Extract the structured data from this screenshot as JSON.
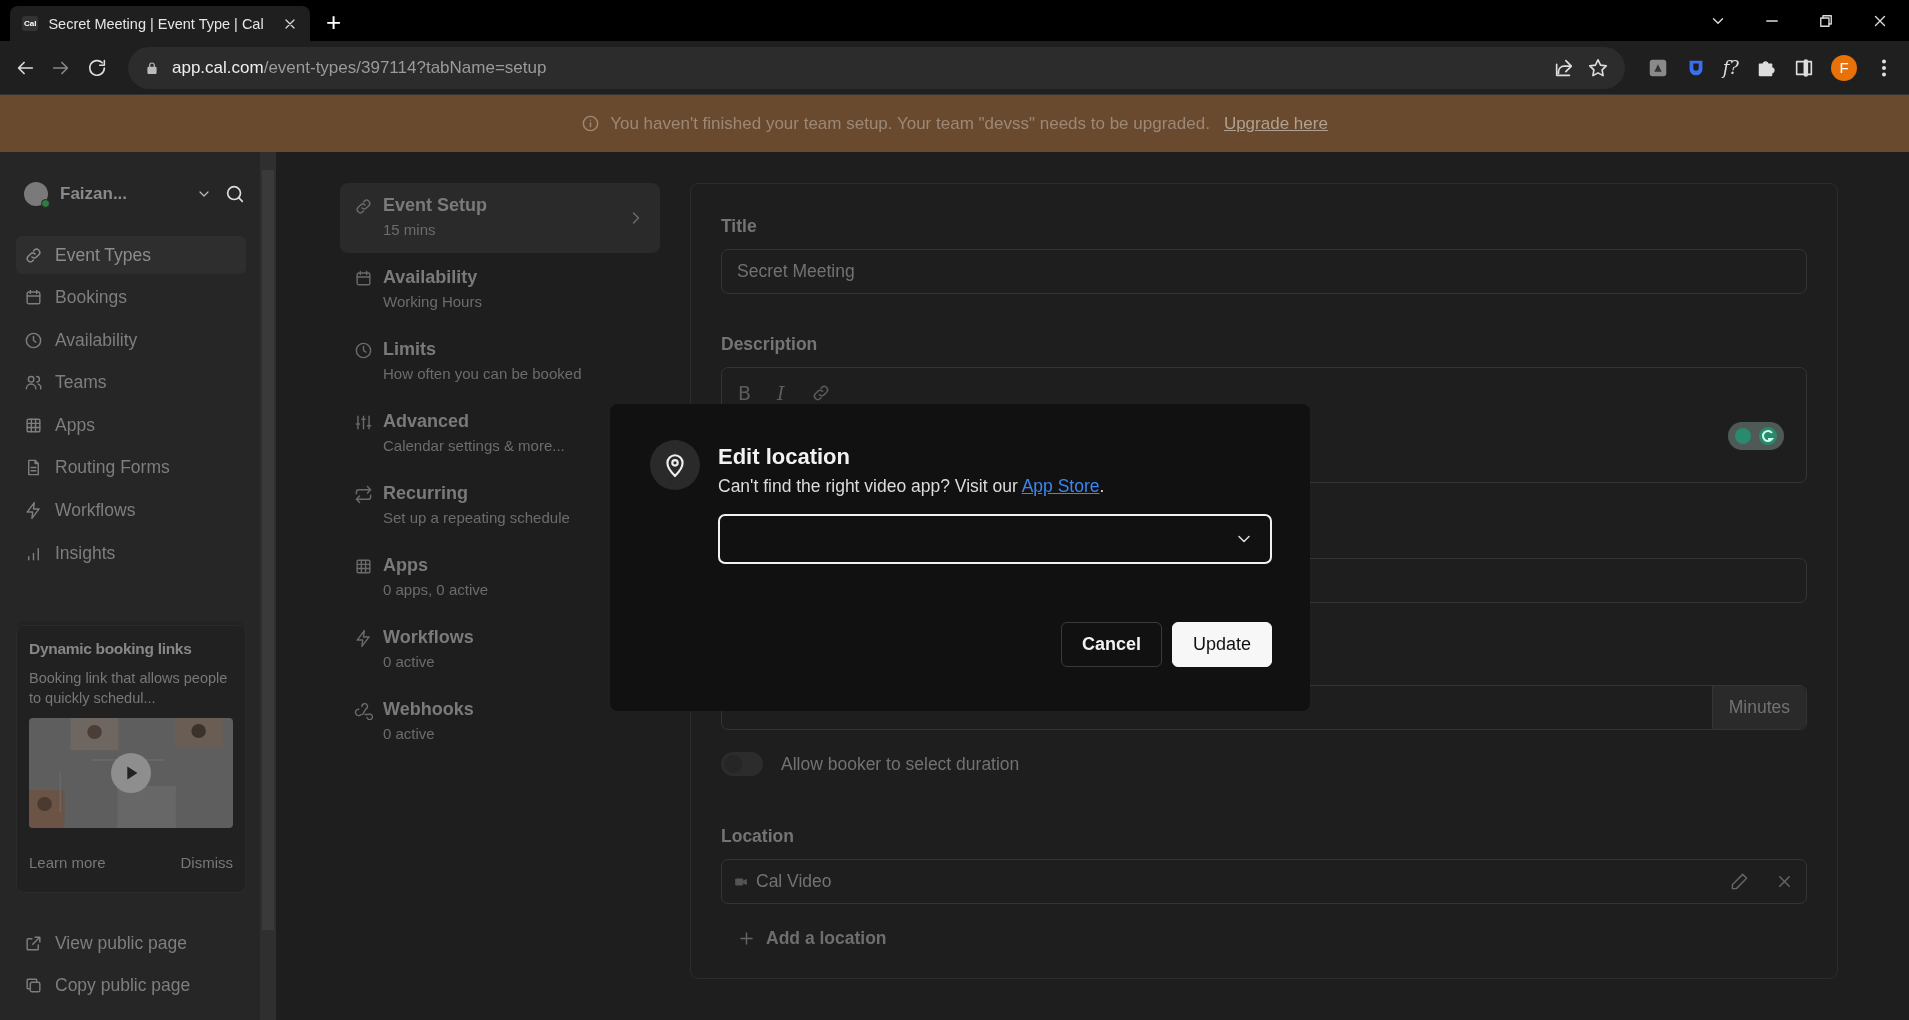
{
  "browser": {
    "tab": {
      "favicon": "Cal",
      "title": "Secret Meeting | Event Type | Cal"
    },
    "new_tab": "+",
    "url_host": "app.cal.com",
    "url_path": "/event-types/397114?tabName=setup",
    "extension_label": "f?",
    "profile_initial": "F"
  },
  "banner": {
    "message": "You haven't finished your team setup. Your team \"devss\" needs to be upgraded.",
    "link": "Upgrade here"
  },
  "sidebar": {
    "user": "Faizan...",
    "online": true,
    "items": [
      {
        "label": "Event Types",
        "selected": true
      },
      {
        "label": "Bookings",
        "selected": false
      },
      {
        "label": "Availability",
        "selected": false
      },
      {
        "label": "Teams",
        "selected": false
      },
      {
        "label": "Apps",
        "selected": false
      },
      {
        "label": "Routing Forms",
        "selected": false
      },
      {
        "label": "Workflows",
        "selected": false
      },
      {
        "label": "Insights",
        "selected": false
      }
    ],
    "promo": {
      "title": "Dynamic booking links",
      "text": "Booking link that allows people to quickly schedul...",
      "learn_more": "Learn more",
      "dismiss": "Dismiss"
    },
    "footer": [
      {
        "label": "View public page"
      },
      {
        "label": "Copy public page"
      }
    ]
  },
  "event_nav": [
    {
      "title": "Event Setup",
      "subtitle": "15 mins",
      "selected": true
    },
    {
      "title": "Availability",
      "subtitle": "Working Hours",
      "selected": false
    },
    {
      "title": "Limits",
      "subtitle": "How often you can be booked",
      "selected": false
    },
    {
      "title": "Advanced",
      "subtitle": "Calendar settings & more...",
      "selected": false
    },
    {
      "title": "Recurring",
      "subtitle": "Set up a repeating schedule",
      "selected": false
    },
    {
      "title": "Apps",
      "subtitle": "0 apps, 0 active",
      "selected": false
    },
    {
      "title": "Workflows",
      "subtitle": "0 active",
      "selected": false
    },
    {
      "title": "Webhooks",
      "subtitle": "0 active",
      "selected": false
    }
  ],
  "form": {
    "title_label": "Title",
    "title_value": "Secret Meeting",
    "description_label": "Description",
    "toolbar": [
      "B",
      "I"
    ],
    "duration_unit": "Minutes",
    "duration_toggle": {
      "label": "Allow booker to select duration",
      "on": false
    },
    "location_label": "Location",
    "locations": [
      "Cal Video"
    ],
    "add_location": "Add a location"
  },
  "modal": {
    "title": "Edit location",
    "text": "Can't find the right video app? Visit our ",
    "link": "App Store",
    "text_end": ".",
    "buttons": [
      {
        "label": "Cancel",
        "kind": "secondary"
      },
      {
        "label": "Update",
        "kind": "primary"
      }
    ]
  }
}
